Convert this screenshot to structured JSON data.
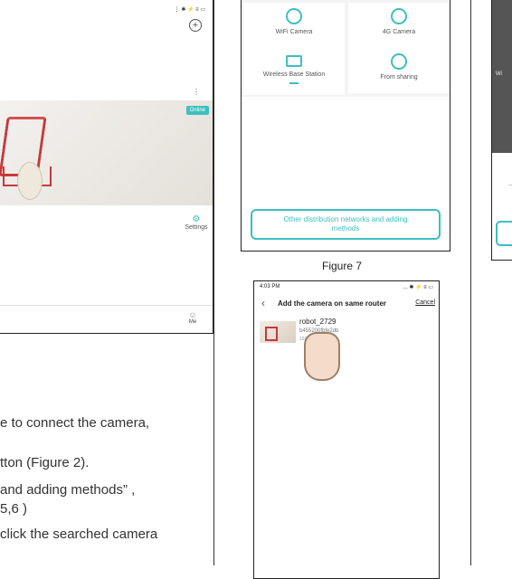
{
  "left_phone": {
    "status": "⋮ ✱ ⚡ ≡ ▭",
    "online_badge": "Online",
    "settings_label": "Settings",
    "me_label": "Me"
  },
  "instructions": {
    "line1": "e to connect the camera,",
    "line2": "tton (Figure 2).",
    "line3": "and adding methods” ,",
    "line4": "5,6 )",
    "line5": "click the searched camera"
  },
  "middle_phone": {
    "tiles": [
      {
        "label": "WiFi Camera"
      },
      {
        "label": "4G Camera"
      },
      {
        "label": "Wireless Base Station"
      },
      {
        "label": "From sharing"
      }
    ],
    "other_button_line1": "Other distribution networks and adding",
    "other_button_line2": "methods"
  },
  "figure_label": "Figure 7",
  "bottom_phone": {
    "time": "4:03 PM",
    "status": "... ✱ ⚡ ≡ ▭",
    "title": "Add the camera on same router",
    "cancel": "Cancel",
    "device_name": "robot_2729",
    "device_id": "b45​5200fbfe2db",
    "device_ip": "192.1"
  },
  "right_phone": {
    "fragment": "Wi"
  }
}
